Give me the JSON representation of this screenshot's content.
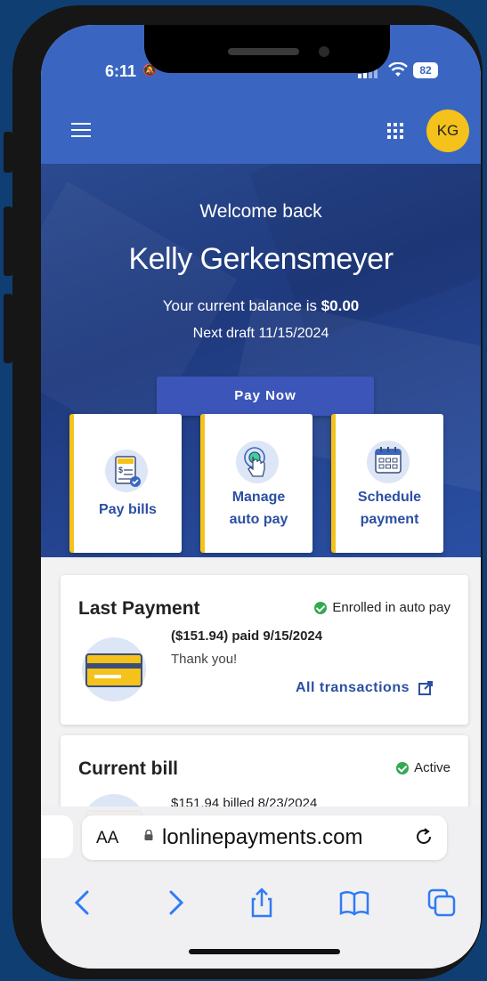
{
  "status_bar": {
    "time": "6:11",
    "battery": "82"
  },
  "app_bar": {
    "avatar_initials": "KG"
  },
  "hero": {
    "welcome": "Welcome back",
    "name": "Kelly Gerkensmeyer",
    "balance_prefix": "Your current balance is ",
    "balance_amount": "$0.00",
    "next_draft": "Next draft 11/15/2024",
    "pay_now_label": "Pay Now"
  },
  "tiles": [
    {
      "line1": "Pay bills",
      "line2": "",
      "icon": "bill-icon"
    },
    {
      "line1": "Manage",
      "line2": "auto pay",
      "icon": "tap-icon"
    },
    {
      "line1": "Schedule",
      "line2": "payment",
      "icon": "calendar-icon"
    }
  ],
  "last_payment": {
    "title": "Last Payment",
    "status": "Enrolled in auto pay",
    "amount_line": "($151.94) paid 9/15/2024",
    "note": "Thank you!",
    "link": "All transactions"
  },
  "current_bill": {
    "title": "Current bill",
    "status": "Active",
    "amount_line": "$151.94 billed 8/23/2024"
  },
  "browser": {
    "aa": "AA",
    "url": "lonlinepayments.com"
  },
  "colors": {
    "accent": "#3a66c2",
    "brand_yellow": "#f4c21a",
    "link": "#2c4fa3",
    "success": "#34a853"
  }
}
